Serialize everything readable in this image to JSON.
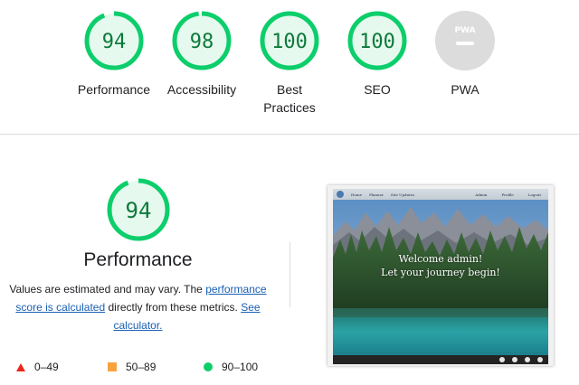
{
  "gauges": [
    {
      "score": "94",
      "label": "Performance",
      "value": 94
    },
    {
      "score": "98",
      "label": "Accessibility",
      "value": 98
    },
    {
      "score": "100",
      "label": "Best Practices",
      "value": 100
    },
    {
      "score": "100",
      "label": "SEO",
      "value": 100
    },
    {
      "score": "",
      "label": "PWA",
      "badge": "PWA"
    }
  ],
  "performance": {
    "score": "94",
    "value": 94,
    "title": "Performance",
    "desc_text1": "Values are estimated and may vary. The",
    "desc_link1": "performance score is calculated",
    "desc_text2": "directly from these metrics.",
    "desc_link2": "See calculator."
  },
  "legend": [
    {
      "range": "0–49",
      "icon": "red-triangle"
    },
    {
      "range": "50–89",
      "icon": "orange-square"
    },
    {
      "range": "90–100",
      "icon": "green-circle"
    }
  ],
  "screenshot": {
    "nav_left": [
      "Home",
      "Planner",
      "Site Updates"
    ],
    "nav_right": [
      "Admin",
      "Profile",
      "Logout"
    ],
    "hero_line1": "Welcome admin!",
    "hero_line2": "Let your journey begin!"
  },
  "colors": {
    "pass": "#0cce6b",
    "pass_text": "#0c7a3a",
    "pass_bg": "#e6f9ee",
    "average": "#f6a33c",
    "fail": "#e8281d",
    "link": "#1a5fb4"
  }
}
